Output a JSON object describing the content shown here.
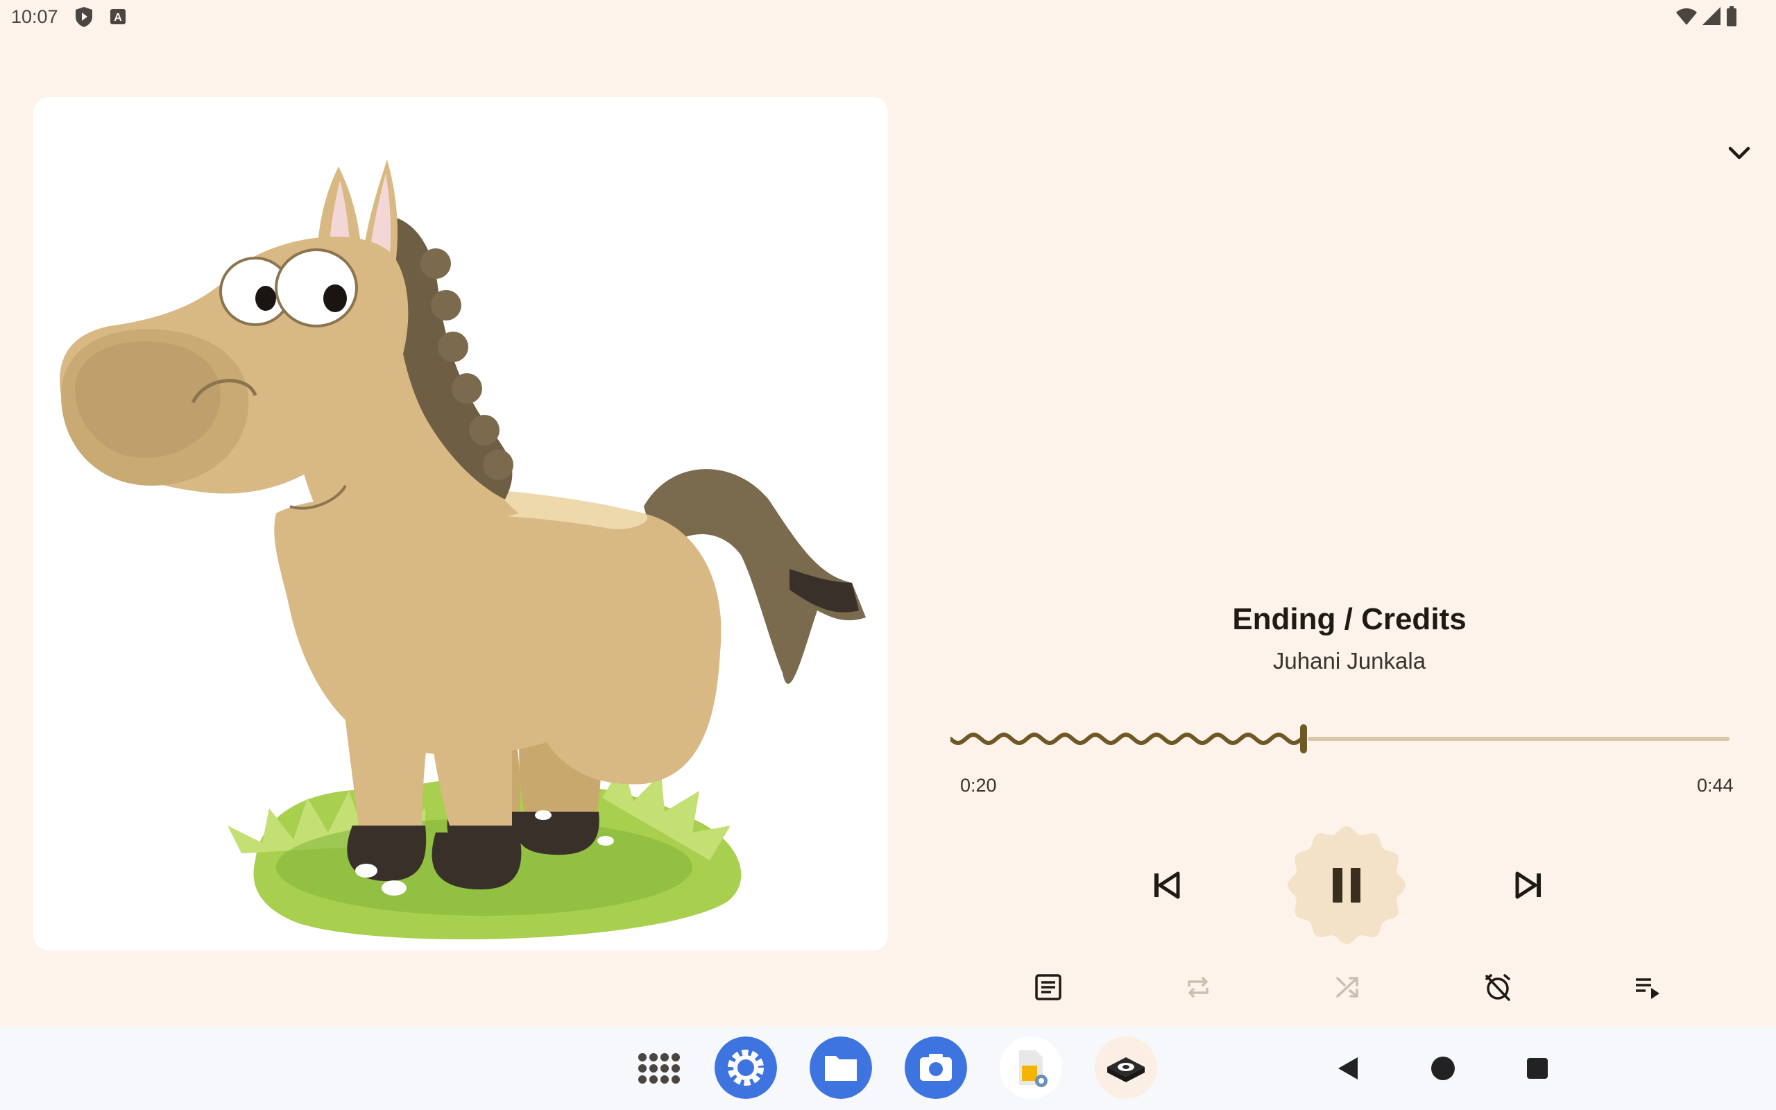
{
  "status_bar": {
    "time": "10:07",
    "left_icons": [
      "play-shield-icon",
      "keyboard-a-icon"
    ],
    "right_icons": [
      "wifi-icon",
      "cell-signal-icon",
      "battery-icon"
    ]
  },
  "now_playing": {
    "album_art": "cartoon-horse-artwork",
    "title": "Ending / Credits",
    "artist": "Juhani Junkala",
    "elapsed": "0:20",
    "total": "0:44",
    "progress": 0.45,
    "is_playing": true
  },
  "controls": {
    "collapse_icon": "chevron-down-icon",
    "previous_icon": "skip-previous-icon",
    "play_pause_icon": "pause-icon",
    "next_icon": "skip-next-icon",
    "lyrics_icon": "lyrics-icon",
    "repeat_icon": "repeat-icon",
    "repeat_enabled": false,
    "shuffle_icon": "shuffle-icon",
    "shuffle_enabled": false,
    "sleep_timer_icon": "alarm-off-icon",
    "queue_icon": "queue-icon"
  },
  "taskbar": {
    "apps": [
      "app-drawer-icon",
      "settings-app-icon",
      "files-app-icon",
      "camera-app-icon",
      "device-settings-app-icon",
      "music-app-icon"
    ],
    "nav": [
      "back-icon",
      "home-icon",
      "recents-icon"
    ]
  },
  "colors": {
    "background": "#fdf3ea",
    "accent": "#6e5826",
    "track_inactive": "#d8c7ab",
    "play_button_bg": "#f3e2c7",
    "taskbar_bg": "#f6f8fb",
    "dock_blue": "#3e74e0"
  }
}
